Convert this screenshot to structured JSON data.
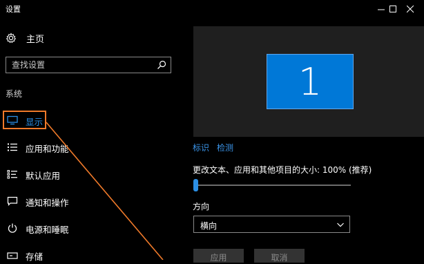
{
  "window": {
    "title": "设置"
  },
  "nav": {
    "home_label": "主页",
    "section_label": "系统",
    "items": [
      {
        "label": "显示",
        "icon": "monitor-icon",
        "active": true
      },
      {
        "label": "应用和功能",
        "icon": "list-icon",
        "active": false
      },
      {
        "label": "默认应用",
        "icon": "default-apps-icon",
        "active": false
      },
      {
        "label": "通知和操作",
        "icon": "message-icon",
        "active": false
      },
      {
        "label": "电源和睡眠",
        "icon": "power-icon",
        "active": false
      },
      {
        "label": "存储",
        "icon": "storage-icon",
        "active": false
      }
    ]
  },
  "search": {
    "placeholder": "查找设置"
  },
  "display": {
    "monitor_number": "1",
    "identify_link": "标识",
    "detect_link": "检测",
    "scale_label": "更改文本、应用和其他项目的大小: 100% (推荐)",
    "scale_value_percent": 0,
    "orientation_label": "方向",
    "orientation_value": "横向",
    "apply_button": "应用",
    "cancel_button": "取消"
  },
  "colors": {
    "accent": "#0078d7",
    "link": "#3b95ea",
    "annotation": "#f07a2a",
    "background": "#000000"
  }
}
